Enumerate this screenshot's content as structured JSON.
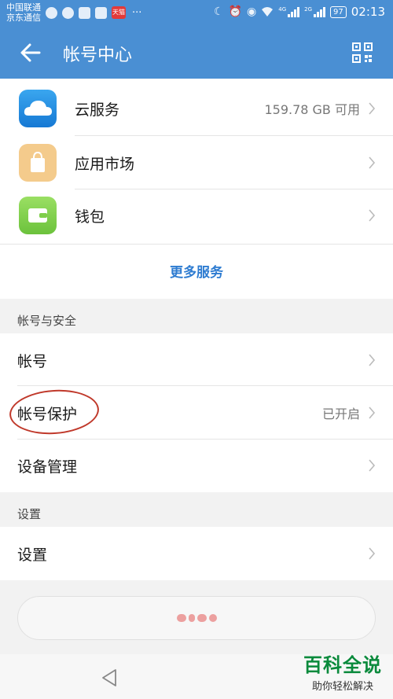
{
  "status_bar": {
    "carrier_1": "中国联通",
    "carrier_2": "京东通信",
    "tmall_label": "天猫",
    "battery": "97",
    "time": "02:13",
    "net_1": "4G",
    "net_2": "2G"
  },
  "app_bar": {
    "title": "帐号中心"
  },
  "services": {
    "items": [
      {
        "label": "云服务",
        "value": "159.78 GB 可用",
        "icon": "cloud-icon",
        "color": "#1f8fe0"
      },
      {
        "label": "应用市场",
        "value": "",
        "icon": "shopping-bag-icon",
        "color": "#f2c27a"
      },
      {
        "label": "钱包",
        "value": "",
        "icon": "wallet-icon",
        "color": "#7fcf4a"
      }
    ],
    "more_label": "更多服务"
  },
  "account_security": {
    "header": "帐号与安全",
    "items": [
      {
        "label": "帐号",
        "value": ""
      },
      {
        "label": "帐号保护",
        "value": "已开启"
      },
      {
        "label": "设备管理",
        "value": ""
      }
    ]
  },
  "settings": {
    "header": "设置",
    "items": [
      {
        "label": "设置",
        "value": ""
      }
    ]
  },
  "watermark": {
    "title": "百科全说",
    "subtitle": "助你轻松解决"
  },
  "colors": {
    "accent": "#4a8fd3",
    "link": "#2e7cd1",
    "annotation": "#c0392b"
  }
}
